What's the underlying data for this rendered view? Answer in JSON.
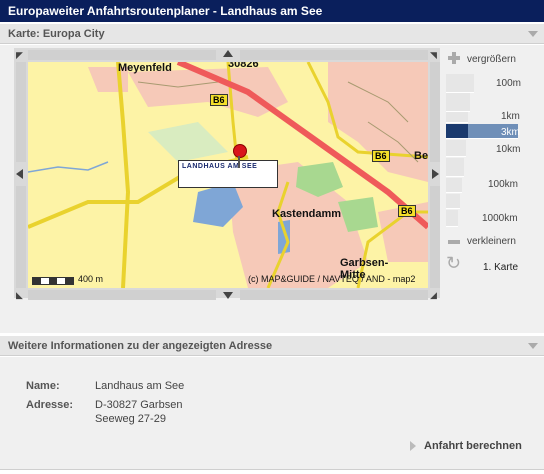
{
  "title": "Europaweiter Anfahrtsroutenplaner - Landhaus am See",
  "map_section": {
    "heading": "Karte: Europa City"
  },
  "map": {
    "places": [
      "Meyenfeld",
      "30826",
      "Kastendamm",
      "Garbsen-",
      "Mitte",
      "Be"
    ],
    "road_badges": [
      "B6",
      "B6",
      "B6"
    ],
    "scale_text": "400 m",
    "copyright": "(c) MAP&GUIDE / NAVTEQ / AND - map2",
    "marker_label": "LANDHAUS AM SEE"
  },
  "zoom": {
    "zoom_in_label": "vergrößern",
    "zoom_out_label": "verkleinern",
    "levels": [
      "100m",
      "1km",
      "3km",
      "10km",
      "100km",
      "1000km"
    ],
    "active_level": "3km",
    "reset_label": "1. Karte"
  },
  "info_section": {
    "heading": "Weitere Informationen zu der angezeigten Adresse",
    "name_label": "Name:",
    "name_value": "Landhaus am See",
    "address_label": "Adresse:",
    "address_line1": "D-30827 Garbsen",
    "address_line2": "Seeweg 27-29",
    "route_button": "Anfahrt berechnen"
  }
}
